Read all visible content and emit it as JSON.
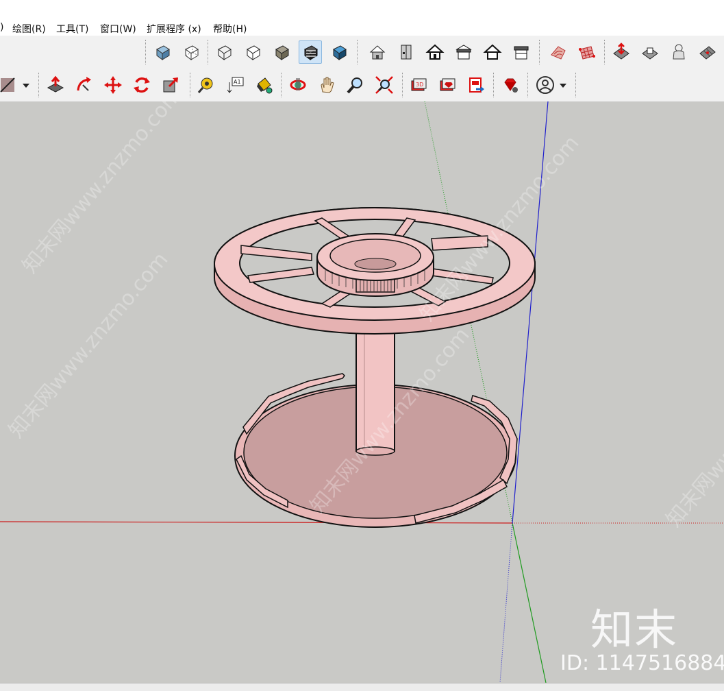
{
  "menu": {
    "partial": ")",
    "draw": "绘图(R)",
    "tools": "工具(T)",
    "window": "窗口(W)",
    "extensions": "扩展程序 (x)",
    "help": "帮助(H)"
  },
  "toolbar_row1": {
    "icons": [
      "xray-icon",
      "back-edges-icon",
      "wireframe-icon",
      "hidden-line-icon",
      "shaded-icon",
      "shaded-with-textures-icon",
      "monochrome-icon",
      "iso-view-icon",
      "top-view-icon",
      "front-view-icon",
      "right-view-icon",
      "back-view-icon",
      "left-view-icon",
      "sandbox-from-contours-icon",
      "sandbox-from-scratch-icon",
      "smoove-icon",
      "stamp-icon",
      "drape-icon",
      "add-detail-icon"
    ],
    "active": "shaded-with-textures-icon"
  },
  "toolbar_row2": {
    "icons": [
      "line-icon",
      "dropdown-arrow-icon",
      "push-pull-icon",
      "follow-me-icon",
      "move-icon",
      "rotate-icon",
      "scale-icon",
      "tape-measure-icon",
      "text-icon",
      "paint-bucket-icon",
      "orbit-icon",
      "pan-icon",
      "zoom-icon",
      "zoom-extents-icon",
      "3d-warehouse-icon",
      "extension-warehouse-icon",
      "send-to-layout-icon",
      "ruby-console-icon",
      "account-icon",
      "account-dropdown-icon"
    ],
    "text_label": "A1"
  },
  "watermark": {
    "logo": "知末",
    "id": "ID: 1147516884",
    "diagonal": "知末网www.znzmo.com"
  },
  "colors": {
    "model_fill": "#f2c4c4",
    "model_dark": "#c99c9c",
    "background": "#c9c9c6",
    "axis_red": "#cc1b1b",
    "axis_green": "#1f9b1f",
    "axis_blue": "#1f1fcc"
  }
}
